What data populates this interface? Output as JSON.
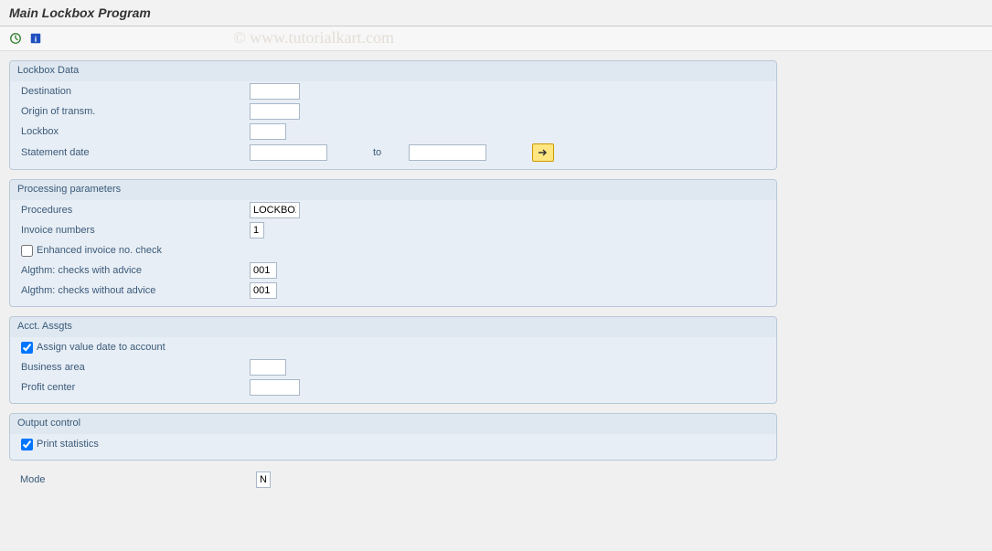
{
  "title": "Main Lockbox Program",
  "watermark": "© www.tutorialkart.com",
  "groups": {
    "lockbox": {
      "title": "Lockbox Data",
      "destination_label": "Destination",
      "destination_value": "",
      "origin_label": "Origin of transm.",
      "origin_value": "",
      "lockbox_label": "Lockbox",
      "lockbox_value": "",
      "stmt_label": "Statement date",
      "stmt_from": "",
      "stmt_to_label": "to",
      "stmt_to": ""
    },
    "processing": {
      "title": "Processing parameters",
      "procedures_label": "Procedures",
      "procedures_value": "LOCKBOX",
      "invoice_label": "Invoice numbers",
      "invoice_value": "1",
      "enhanced_label": "Enhanced invoice no. check",
      "enhanced_checked": false,
      "algthm_with_label": "Algthm: checks with advice",
      "algthm_with_value": "001",
      "algthm_without_label": "Algthm: checks without advice",
      "algthm_without_value": "001"
    },
    "acct": {
      "title": "Acct. Assgts",
      "assign_label": "Assign value date to account",
      "assign_checked": true,
      "business_label": "Business area",
      "business_value": "",
      "profit_label": "Profit center",
      "profit_value": ""
    },
    "output": {
      "title": "Output control",
      "print_label": "Print statistics",
      "print_checked": true
    }
  },
  "mode_label": "Mode",
  "mode_value": "N"
}
